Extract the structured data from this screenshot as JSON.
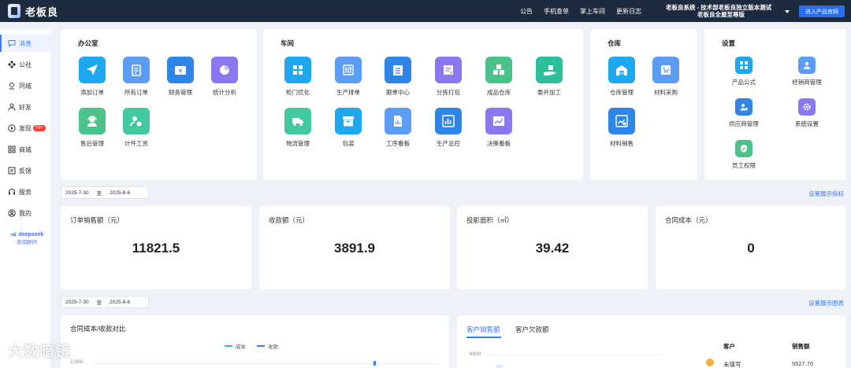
{
  "app": {
    "name": "老板良",
    "system_line1": "老板良系统 - 技术部老板良独立版本测试",
    "system_line2": "老板良全屋至尊版",
    "enter_button": "进入产品官网"
  },
  "topnav": [
    "公告",
    "手机查单",
    "掌上车间",
    "更新日志"
  ],
  "sidebar": {
    "items": [
      {
        "label": "消息",
        "icon": "chat-icon",
        "active": true
      },
      {
        "label": "公社",
        "icon": "community-icon"
      },
      {
        "label": "同城",
        "icon": "location-icon"
      },
      {
        "label": "好友",
        "icon": "user-icon"
      },
      {
        "label": "发现",
        "icon": "play-circle-icon",
        "badge": "99+"
      },
      {
        "label": "商城",
        "icon": "grid-icon"
      },
      {
        "label": "反馈",
        "icon": "feedback-icon"
      },
      {
        "label": "服务",
        "icon": "headset-icon"
      },
      {
        "label": "我的",
        "icon": "profile-icon"
      }
    ],
    "deepseek_brand": "deepseek",
    "deepseek_label": "咨询顾问"
  },
  "sections": {
    "office": {
      "title": "办公室",
      "tiles": [
        {
          "label": "添加订单",
          "icon": "send-icon",
          "color": "#1fa7f0"
        },
        {
          "label": "所有订单",
          "icon": "clipboard-icon",
          "color": "#5b9cf5"
        },
        {
          "label": "财务管理",
          "icon": "yuan-wallet-icon",
          "color": "#2f86e8"
        },
        {
          "label": "统计分析",
          "icon": "pie-chart-icon",
          "color": "#8a78f0"
        },
        {
          "label": "售后管理",
          "icon": "support-agent-icon",
          "color": "#4cc38a"
        },
        {
          "label": "计件工资",
          "icon": "person-coin-icon",
          "color": "#43c9a0"
        }
      ]
    },
    "workshop": {
      "title": "车间",
      "tiles": [
        {
          "label": "柜门优化",
          "icon": "layout-grid-icon",
          "color": "#1fa7f0"
        },
        {
          "label": "生产排单",
          "icon": "sliders-icon",
          "color": "#5b9cf5"
        },
        {
          "label": "跟单中心",
          "icon": "calendar-list-icon",
          "color": "#2f86e8"
        },
        {
          "label": "分拣打包",
          "icon": "checklist-icon",
          "color": "#8a78f0"
        },
        {
          "label": "成品仓库",
          "icon": "boxes-icon",
          "color": "#4cc38a"
        },
        {
          "label": "委外加工",
          "icon": "hand-box-icon",
          "color": "#2bbf9a"
        },
        {
          "label": "物流管理",
          "icon": "truck-icon",
          "color": "#43c9a0"
        },
        {
          "label": "包装",
          "icon": "archive-box-icon",
          "color": "#1fa7f0"
        },
        {
          "label": "工序看板",
          "icon": "document-chart-icon",
          "color": "#5b9cf5"
        },
        {
          "label": "生产总控",
          "icon": "bar-chart-icon",
          "color": "#2f86e8"
        },
        {
          "label": "决策看板",
          "icon": "trend-chart-icon",
          "color": "#8a78f0"
        }
      ]
    },
    "warehouse": {
      "title": "仓库",
      "tiles": [
        {
          "label": "仓库管理",
          "icon": "warehouse-icon",
          "color": "#1fa7f0"
        },
        {
          "label": "材料采购",
          "icon": "cart-icon",
          "color": "#5b9cf5"
        },
        {
          "label": "材料销售",
          "icon": "sales-chart-icon",
          "color": "#2f86e8"
        }
      ]
    },
    "settings": {
      "title": "设置",
      "tiles": [
        {
          "label": "产品公式",
          "icon": "formula-grid-icon",
          "color": "#1fa7f0"
        },
        {
          "label": "经销商管理",
          "icon": "dealer-icon",
          "color": "#5b9cf5"
        },
        {
          "label": "供应商管理",
          "icon": "supplier-icon",
          "color": "#2f86e8"
        },
        {
          "label": "系统设置",
          "icon": "gear-icon",
          "color": "#8a78f0"
        },
        {
          "label": "员工权限",
          "icon": "shield-icon",
          "color": "#4cc38a"
        }
      ]
    }
  },
  "date_range_1": {
    "start": "2025-7-30",
    "sep": "至",
    "end": "2025-8-6"
  },
  "set_metrics_link": "设置展示指标",
  "kpis": [
    {
      "title": "订单销售额（元）",
      "value": "11821.5"
    },
    {
      "title": "收款额（元）",
      "value": "3891.9"
    },
    {
      "title": "投影面积（㎡）",
      "value": "39.42"
    },
    {
      "title": "合同成本（元）",
      "value": "0"
    }
  ],
  "date_range_2": {
    "start": "2025-7-30",
    "sep": "至",
    "end": "2025-8-6"
  },
  "set_charts_link": "设置展示图表",
  "chart_left": {
    "title": "合同成本/收款对比",
    "legend": [
      {
        "name": "成本",
        "color": "#2fb8c9"
      },
      {
        "name": "收款",
        "color": "#3a7bff"
      }
    ],
    "y_tick_visible": "2,500"
  },
  "chart_right": {
    "tabs": [
      "客户销售额",
      "客户欠款额"
    ],
    "active_tab": 0,
    "y_tick_visible": "6000",
    "table_headers": [
      "客户",
      "销售额"
    ],
    "rows": [
      {
        "customer": "未填写",
        "amount": "5527.70"
      }
    ]
  },
  "watermark": "大数暗镜"
}
